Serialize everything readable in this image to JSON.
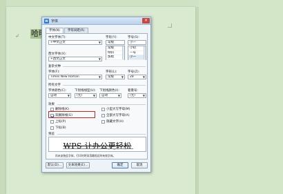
{
  "document": {
    "text": "哈明",
    "anchor_icon": "paragraph-mark-icon"
  },
  "dialog": {
    "title": "字体",
    "icon_label": "W",
    "close_icon": "close-icon",
    "tabs": [
      {
        "label": "字体(N)"
      },
      {
        "label": "字符间距(R)"
      }
    ],
    "chinese_font": {
      "label": "中文字体(T):",
      "value": "+中文正文"
    },
    "style": {
      "label": "字形(Y):",
      "value": "常规",
      "options": [
        "常规",
        "倾斜",
        "加粗"
      ]
    },
    "size": {
      "label": "字号(S):",
      "value": "小一",
      "options": [
        "小初",
        "一号",
        "小一"
      ]
    },
    "western_font": {
      "label": "西文字体(X):",
      "value": "+西文正文"
    },
    "complex": {
      "section_title": "复杂文种",
      "font_label": "字体(F):",
      "font_value": "Times New Roman",
      "style_label": "字形(L):",
      "style_value": "常规",
      "size_label": "字号(Z):",
      "size_value": "28"
    },
    "all_text": {
      "section_title": "所有文字",
      "color_label": "字体颜色(C):",
      "color_value": "自动",
      "underline_label": "下划线线型(U):",
      "underline_value": "(无)",
      "underline_color_label": "下划线颜色(I):",
      "underline_color_value": "自动",
      "emphasis_label": "着重号:",
      "emphasis_value": "(无)"
    },
    "effects": {
      "section_title": "效果",
      "left": [
        {
          "label": "删除线(K)",
          "checked": false
        },
        {
          "label": "双删除线(G)",
          "checked": true
        },
        {
          "label": "上标(P)",
          "checked": false
        },
        {
          "label": "下标(B)",
          "checked": false
        }
      ],
      "right": [
        {
          "label": "小型大写字母(M)",
          "checked": false
        },
        {
          "label": "全部大写字母(A)",
          "checked": false
        },
        {
          "label": "隐藏文字(H)",
          "checked": false
        }
      ]
    },
    "preview": {
      "section_title": "预览",
      "sample": "WPS 让办公更轻松",
      "note": "尚未安装此字体，打印时将采用最相近的有效字体。"
    },
    "buttons": {
      "default": "默认(D)...",
      "text_effects": "文本效果(E)...",
      "ok": "确定",
      "cancel": "取消"
    }
  }
}
